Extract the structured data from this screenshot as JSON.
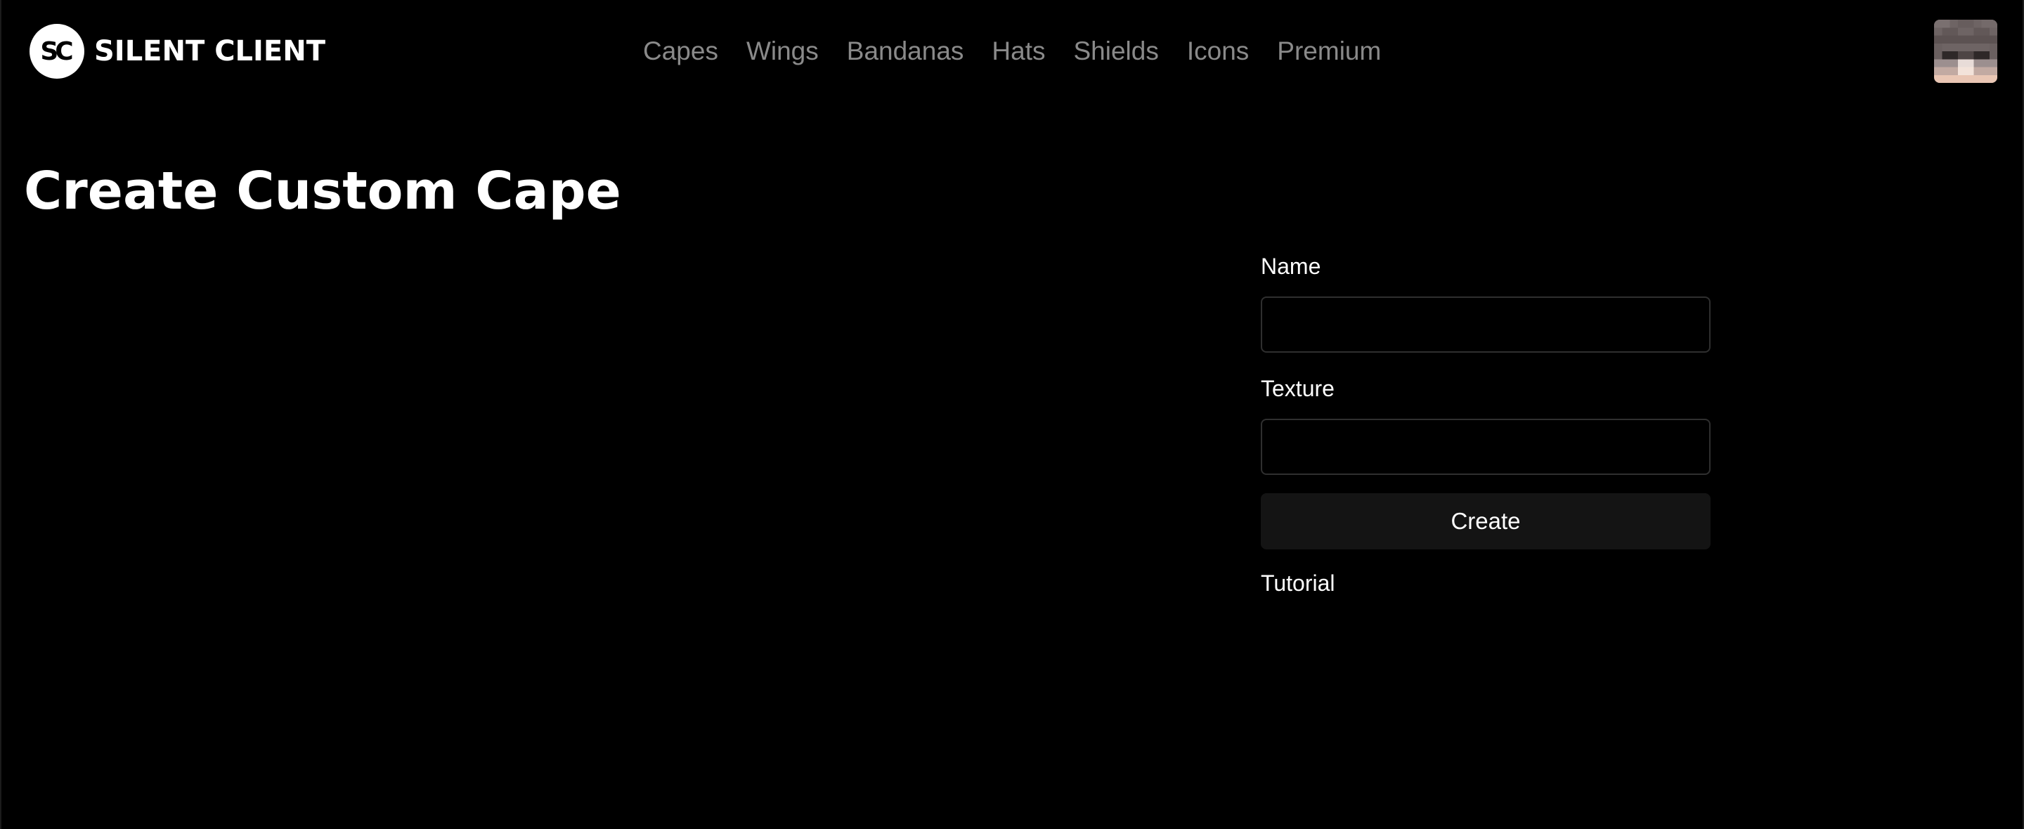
{
  "brand": {
    "logo_text": "SC",
    "name": "SILENT CLIENT"
  },
  "nav": {
    "items": [
      {
        "label": "Capes"
      },
      {
        "label": "Wings"
      },
      {
        "label": "Bandanas"
      },
      {
        "label": "Hats"
      },
      {
        "label": "Shields"
      },
      {
        "label": "Icons"
      },
      {
        "label": "Premium"
      }
    ]
  },
  "user": {
    "avatar_icon": "minecraft-skin-head-icon"
  },
  "main": {
    "title": "Create Custom Cape",
    "form": {
      "name_label": "Name",
      "name_value": "",
      "texture_label": "Texture",
      "texture_value": "",
      "create_label": "Create",
      "tutorial_label": "Tutorial"
    }
  },
  "colors": {
    "background": "#000000",
    "text": "#ffffff",
    "nav_text": "#8a8a8a",
    "input_border": "#2f2f2f",
    "button_bg": "#141414"
  }
}
